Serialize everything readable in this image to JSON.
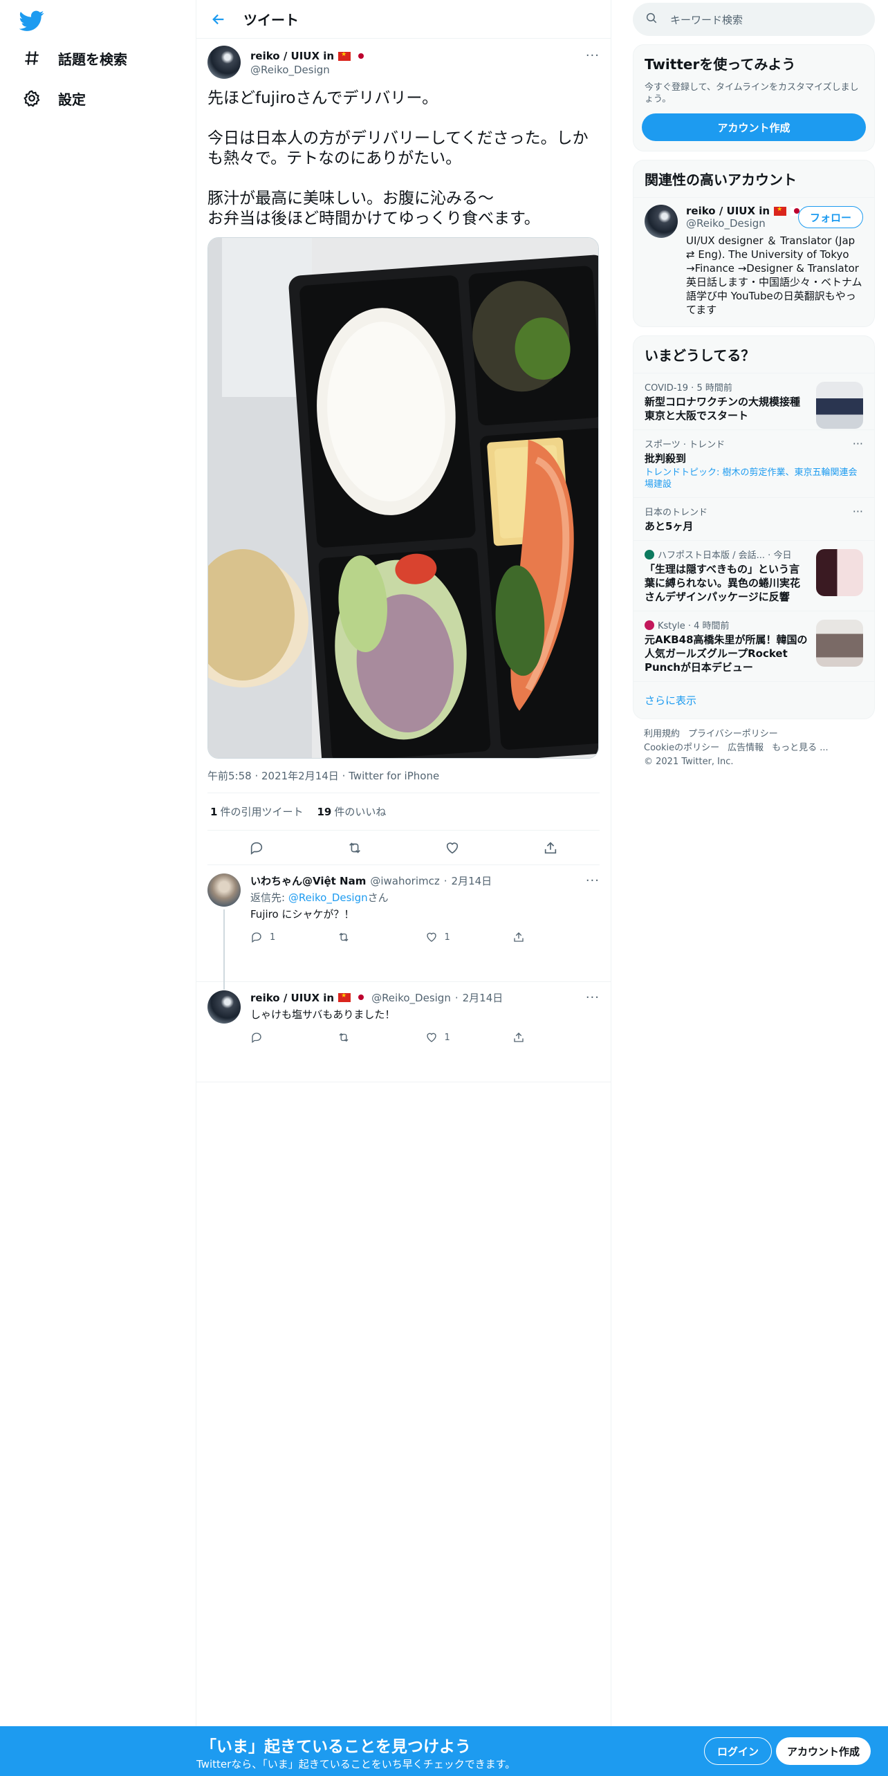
{
  "nav": {
    "items": [
      {
        "label": "話題を検索",
        "icon": "hashtag-icon"
      },
      {
        "label": "設定",
        "icon": "gear-icon"
      }
    ]
  },
  "header": {
    "title": "ツイート"
  },
  "tweet": {
    "author_name": "reiko / UIUX in",
    "handle": "@Reiko_Design",
    "text": "先ほどfujiroさんでデリバリー。\n\n今日は日本人の方がデリバリーしてくださった。しかも熱々で。テトなのにありがたい。\n\n豚汁が最高に美味しい。お腹に沁みる〜\nお弁当は後ほど時間かけてゆっくり食べます。",
    "time": "午前5:58",
    "date": "2021年2月14日",
    "source": "Twitter for iPhone",
    "quote_count": "1",
    "quote_label": "件の引用ツイート",
    "like_count": "19",
    "like_label": "件のいいね"
  },
  "replies": [
    {
      "name": "いわちゃん@Việt Nam",
      "handle": "@iwahorimcz",
      "date": "2月14日",
      "reply_to_label": "返信先:",
      "reply_to_handle": "@Reiko_Design",
      "reply_to_suffix": "さん",
      "text": "Fujiro にシャケが？！",
      "reply_count": "1",
      "retweet_count": "",
      "like_count": "1"
    },
    {
      "name": "reiko / UIUX in",
      "handle": "@Reiko_Design",
      "date": "2月14日",
      "text": "しゃけも塩サバもありました！",
      "reply_count": "",
      "retweet_count": "",
      "like_count": "1"
    }
  ],
  "search": {
    "placeholder": "キーワード検索"
  },
  "signup_card": {
    "title": "Twitterを使ってみよう",
    "subtitle": "今すぐ登録して、タイムラインをカスタマイズしましょう。",
    "button": "アカウント作成"
  },
  "related": {
    "title": "関連性の高いアカウント",
    "name": "reiko / UIUX in",
    "handle": "@Reiko_Design",
    "follow": "フォロー",
    "bio": "UI/UX designer ＆ Translator (Jap ⇄ Eng). The University of Tokyo →Finance →Designer & Translator 英日話します・中国語少々・ベトナム語学び中 YouTubeの日英翻訳もやってます"
  },
  "trends": {
    "title": "いまどうしてる？",
    "items": [
      {
        "context": "COVID-19 · 5 時間前",
        "title": "新型コロナワクチンの大規模接種 東京と大阪でスタート"
      },
      {
        "context": "スポーツ · トレンド",
        "title": "批判殺到",
        "topics": "トレンドトピック: 樹木の剪定作業、東京五輪関連会場建設"
      },
      {
        "context": "日本のトレンド",
        "title": "あと5ヶ月"
      },
      {
        "context": "ハフポスト日本版 / 会話... · 今日",
        "title": "「生理は隠すべきもの」という言葉に縛られない。異色の蜷川実花さんデザインパッケージに反響"
      },
      {
        "context": "Kstyle · 4 時間前",
        "title": "元AKB48高橋朱里が所属！韓国の人気ガールズグループRocket Punchが日本デビュー"
      }
    ],
    "show_more": "さらに表示"
  },
  "footer": {
    "terms": "利用規約",
    "privacy": "プライバシーポリシー",
    "cookie": "Cookieのポリシー",
    "ads": "広告情報",
    "more": "もっと見る ...",
    "copyright": "© 2021 Twitter, Inc."
  },
  "bottom_bar": {
    "headline": "「いま」起きていることを見つけよう",
    "sub": "Twitterなら、「いま」起きていることをいち早くチェックできます。",
    "login": "ログイン",
    "signup": "アカウント作成"
  },
  "colors": {
    "accent": "#1d9bf0",
    "text": "#0f1419",
    "muted": "#536471"
  }
}
